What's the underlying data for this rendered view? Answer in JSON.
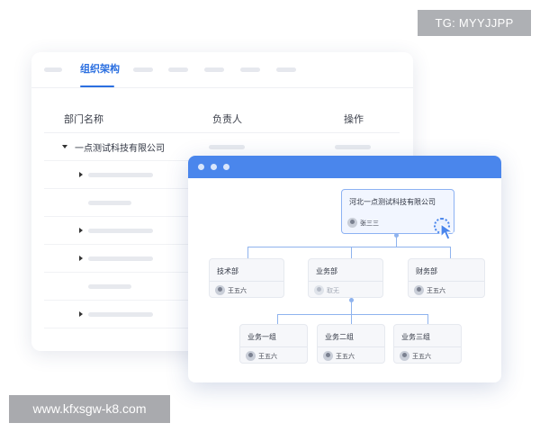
{
  "watermarks": {
    "top_right": "TG: MYYJJPP",
    "bottom_left": "www.kfxsgw-k8.com"
  },
  "back_window": {
    "active_tab": "组织架构",
    "table": {
      "headers": [
        "部门名称",
        "负责人",
        "操作"
      ],
      "root_row": "一点测试科技有限公司"
    }
  },
  "org_chart": {
    "root": {
      "title": "河北一点测试科技有限公司",
      "person": "张三三"
    },
    "level2": [
      {
        "title": "技术部",
        "person": "王五六"
      },
      {
        "title": "业务部",
        "person": "取无"
      },
      {
        "title": "财务部",
        "person": "王五六"
      }
    ],
    "level3": [
      {
        "title": "业务一组",
        "person": "王五六"
      },
      {
        "title": "业务二组",
        "person": "王五六"
      },
      {
        "title": "业务三组",
        "person": "王五六"
      }
    ]
  },
  "colors": {
    "accent": "#2b6fe0",
    "titlebar": "#4a86ec",
    "connector": "#8fb3ee"
  },
  "icons": [
    "avatar-icon",
    "pointer-cursor-icon",
    "caret-down-icon",
    "caret-right-icon"
  ]
}
